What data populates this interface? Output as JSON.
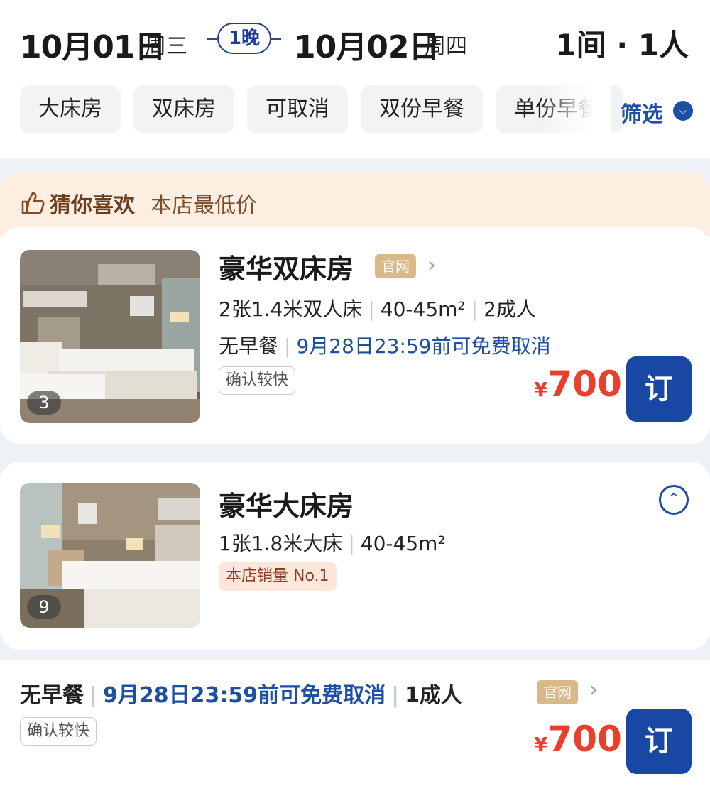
{
  "header": {
    "checkin_date": "10月01日",
    "checkin_week": "周三",
    "nights": "1晚",
    "checkout_date": "10月02日",
    "checkout_week": "周四",
    "guests": "1间 · 1人"
  },
  "filters": {
    "chips": [
      "大床房",
      "双床房",
      "可取消",
      "双份早餐",
      "单份早餐"
    ],
    "filter_label": "筛选",
    "filter_icon": "chevron-down-icon"
  },
  "recommend": {
    "title": "猜你喜欢",
    "subtitle": "本店最低价"
  },
  "room1": {
    "name": "豪华双床房",
    "badge": "官网",
    "photo_count": "3",
    "bed": "2张1.4米双人床",
    "area": "40-45m²",
    "occupancy": "2成人",
    "breakfast": "无早餐",
    "cancel": "9月28日23:59前可免费取消",
    "tag": "确认较快",
    "currency": "¥",
    "price": "700",
    "book": "订"
  },
  "room2": {
    "name": "豪华大床房",
    "photo_count": "9",
    "bed": "1张1.8米大床",
    "area": "40-45m²",
    "tag": "本店销量 No.1"
  },
  "rate": {
    "breakfast": "无早餐",
    "cancel": "9月28日23:59前可免费取消",
    "occupancy": "1成人",
    "badge": "官网",
    "tag": "确认较快",
    "currency": "¥",
    "price": "700",
    "book": "订"
  },
  "colors": {
    "accent_blue": "#1d4fa3",
    "price_red": "#e8402a",
    "book_button": "#1848a3",
    "recommend_bg": "#fdeee2"
  }
}
